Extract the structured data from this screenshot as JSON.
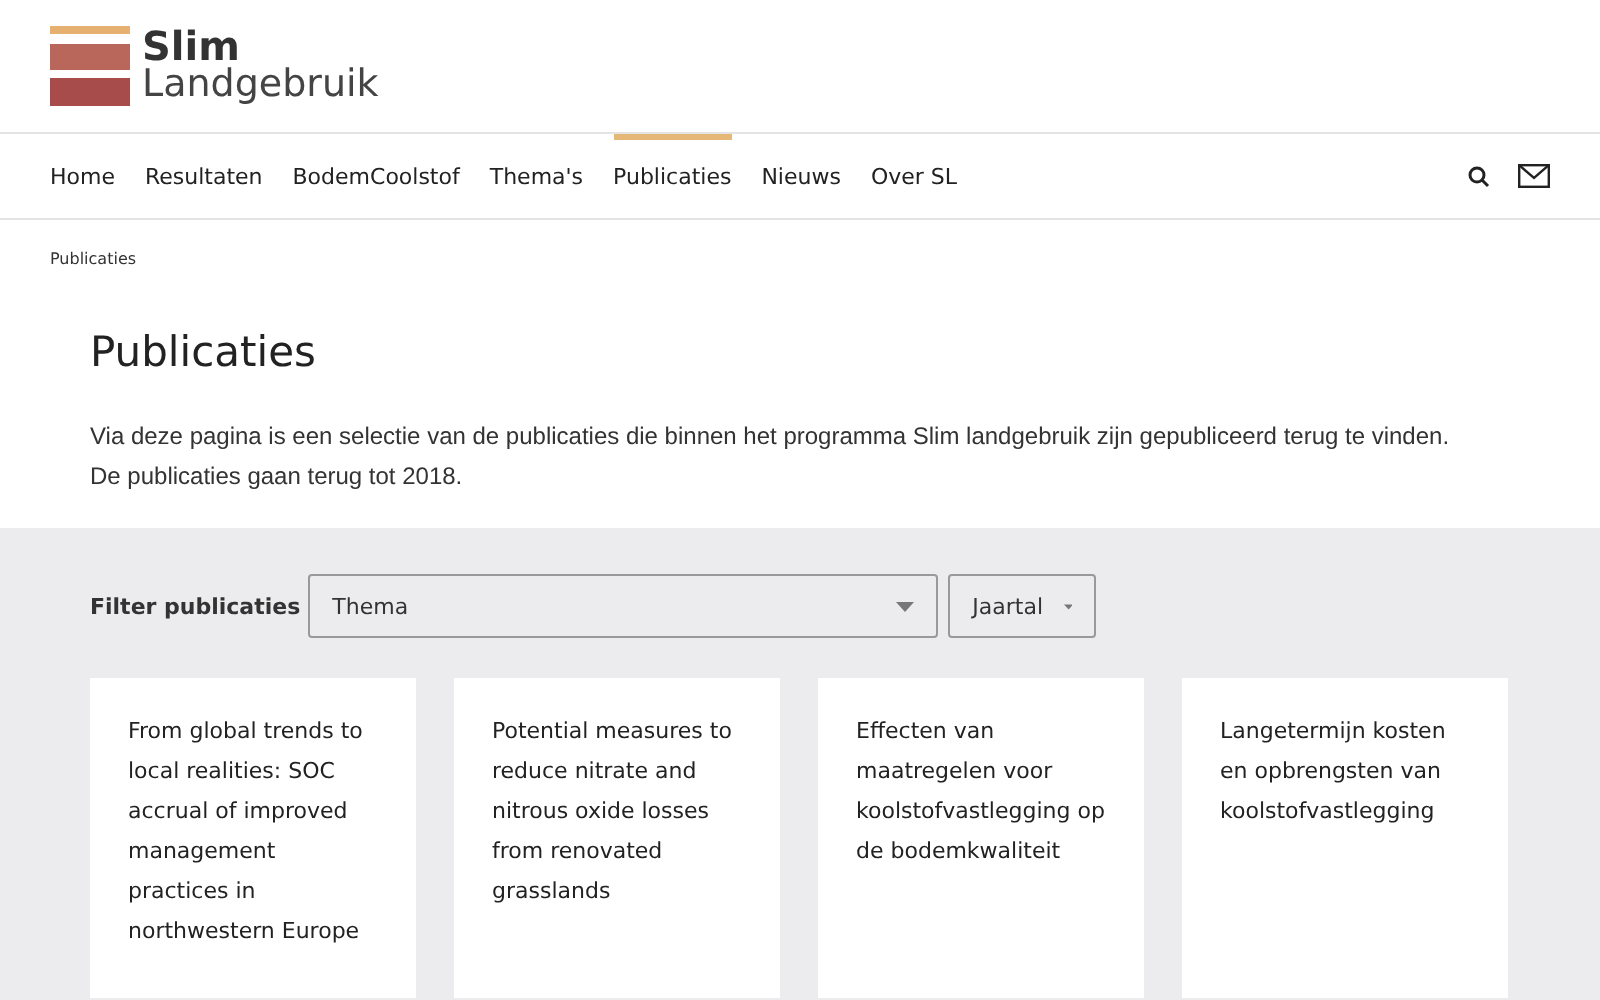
{
  "logo": {
    "line1": "Slim",
    "line2": "Landgebruik"
  },
  "nav": [
    {
      "label": "Home",
      "selected": false
    },
    {
      "label": "Resultaten",
      "selected": false
    },
    {
      "label": "BodemCoolstof",
      "selected": false
    },
    {
      "label": "Thema's",
      "selected": false
    },
    {
      "label": "Publicaties",
      "selected": true
    },
    {
      "label": "Nieuws",
      "selected": false
    },
    {
      "label": "Over SL",
      "selected": false
    }
  ],
  "breadcrumb": "Publicaties",
  "title": "Publicaties",
  "intro": [
    "Via deze pagina is een selectie van de publicaties die binnen het programma Slim landgebruik zijn gepubliceerd terug te vinden.",
    "De publicaties gaan terug tot 2018."
  ],
  "filter": {
    "label": "Filter publicaties",
    "theme_select": "Thema",
    "year_select": "Jaartal"
  },
  "cards": [
    {
      "title": "From global trends to local realities: SOC accrual of improved management practices in northwestern Europe"
    },
    {
      "title": "Potential measures to reduce nitrate and nitrous oxide losses from renovated grasslands"
    },
    {
      "title": "Effecten van maatregelen voor koolstofvastlegging op de bodemkwaliteit"
    },
    {
      "title": "Langetermijn kosten en opbrengsten van koolstofvastlegging"
    }
  ]
}
